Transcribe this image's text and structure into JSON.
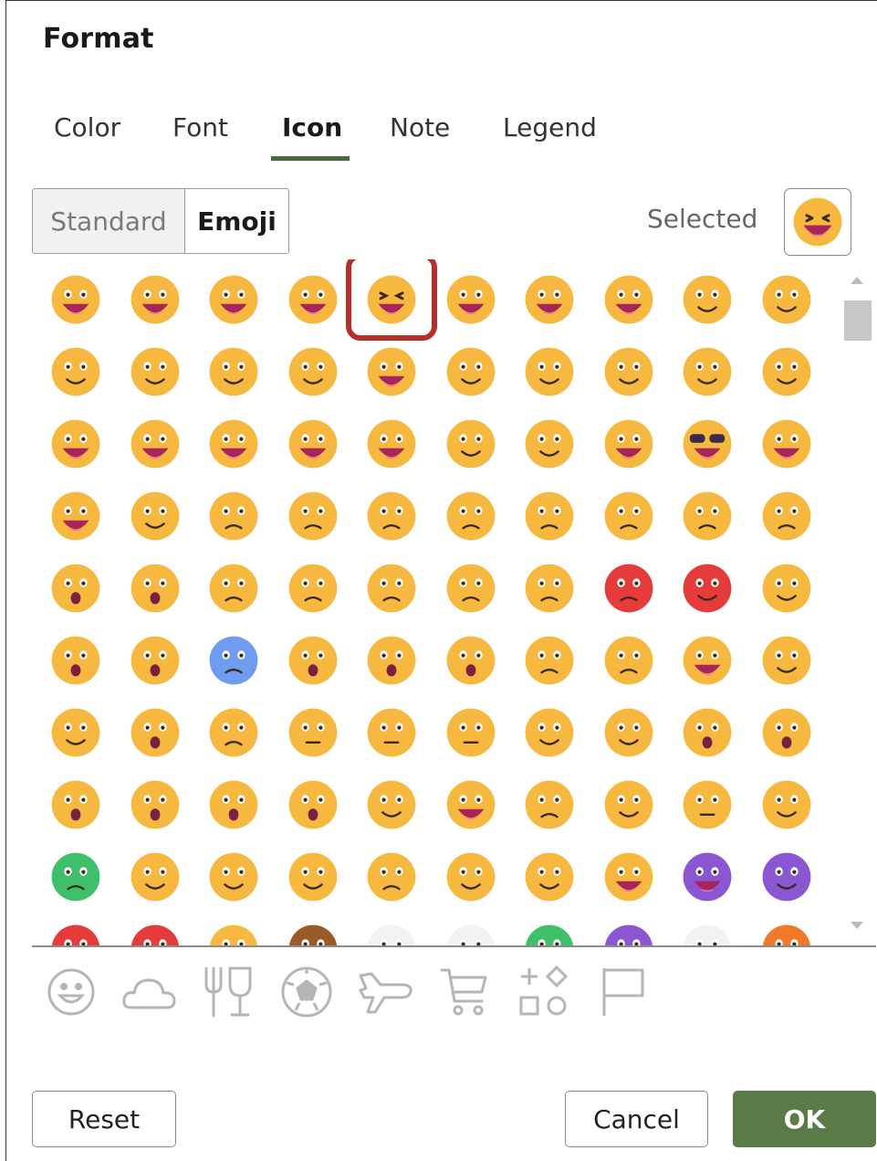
{
  "dialog": {
    "title": "Format"
  },
  "tabs": [
    {
      "label": "Color",
      "active": false
    },
    {
      "label": "Font",
      "active": false
    },
    {
      "label": "Icon",
      "active": true
    },
    {
      "label": "Note",
      "active": false
    },
    {
      "label": "Legend",
      "active": false
    }
  ],
  "icon_type": {
    "standard_label": "Standard",
    "emoji_label": "Emoji",
    "active": "Emoji"
  },
  "selected": {
    "label": "Selected",
    "icon": "grinning-squinting-face-icon"
  },
  "grid": {
    "selected_index": 4,
    "colors": {
      "face": "#f7b840",
      "red": "#e53b3b",
      "blue": "#6f9bf0",
      "green": "#3fbf6a",
      "purple": "#8a56d1",
      "highlight": "#b3312a"
    },
    "rows": [
      [
        "grinning-face",
        "grinning-big-eyes",
        "grinning-smiling-eyes",
        "beaming-face",
        "grinning-squinting-face",
        "grinning-sweat",
        "rolling-floor-laughing",
        "tears-of-joy",
        "smiling-eyes",
        "halo"
      ],
      [
        "slightly-smiling",
        "upside-down",
        "winking",
        "relieved",
        "heart-eyes",
        "smiling-hearts",
        "face-blowing-kiss",
        "kissing-face",
        "kissing-smiling-eyes",
        "kissing-closed-eyes"
      ],
      [
        "savoring-food",
        "tongue-out",
        "squinting-tongue",
        "winking-tongue",
        "zany-face",
        "raised-eyebrow",
        "monocle",
        "nerd-face",
        "sunglasses",
        "star-struck"
      ],
      [
        "partying-face",
        "smirking",
        "unamused",
        "disappointed",
        "pensive",
        "worried",
        "confused",
        "slightly-frowning",
        "persevering",
        "confounded"
      ],
      [
        "tired",
        "weary",
        "pleading",
        "crying",
        "loudly-crying",
        "steam-from-nose",
        "angry",
        "pouting",
        "cursing",
        "exploding-head"
      ],
      [
        "flushed",
        "hot-face",
        "cold-face",
        "screaming",
        "fearful",
        "anxious-sweat",
        "sad-relieved",
        "downcast-sweat",
        "hugging",
        "thinking"
      ],
      [
        "hand-over-mouth",
        "shushing",
        "lying",
        "no-mouth",
        "neutral",
        "expressionless",
        "grimacing",
        "rolling-eyes",
        "hushed",
        "open-mouth"
      ],
      [
        "astonished",
        "anguished",
        "frowning-open-mouth",
        "yawning",
        "sleeping",
        "drooling",
        "sleepy",
        "dizzy",
        "zipper-mouth",
        "woozy"
      ],
      [
        "nauseated",
        "vomiting",
        "sneezing",
        "medical-mask",
        "thermometer",
        "head-bandage",
        "money-mouth",
        "cowboy",
        "smiling-devil",
        "angry-devil"
      ],
      [
        "ogre",
        "goblin",
        "clown",
        "pile-of-poo",
        "ghost",
        "skull",
        "alien",
        "alien-monster",
        "robot",
        "jack-o-lantern"
      ]
    ]
  },
  "categories": [
    "smiley-icon",
    "cloud-icon",
    "fork-and-glass-icon",
    "soccer-ball-icon",
    "plane-icon",
    "shopping-cart-icon",
    "symbols-icon",
    "flag-icon"
  ],
  "buttons": {
    "reset": "Reset",
    "cancel": "Cancel",
    "ok": "OK"
  }
}
